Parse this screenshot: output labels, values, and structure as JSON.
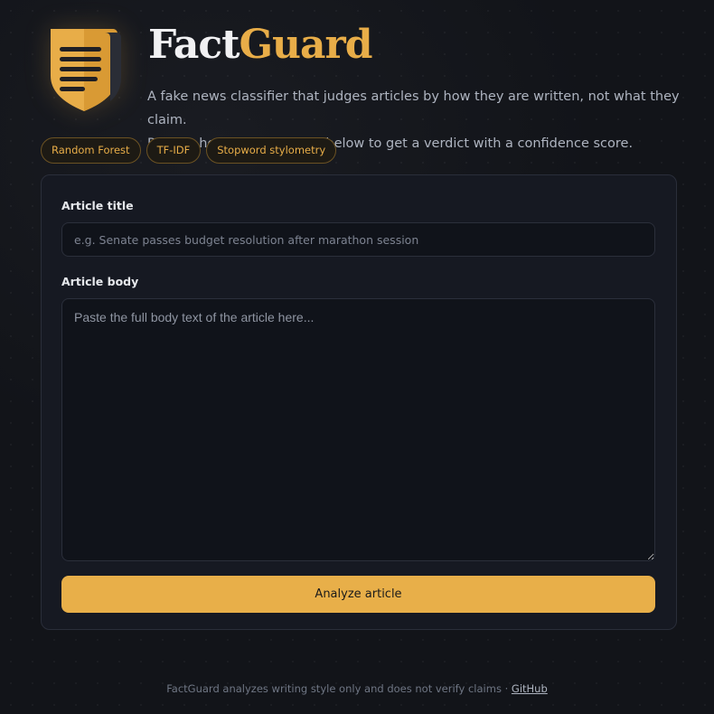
{
  "app": {
    "logo_icon": "shield-document-icon",
    "brand_part1": "Fact",
    "brand_part2": "Guard",
    "brand_accent_color": "#e8ad48",
    "description_line1": "A fake news classifier that judges articles by how they are written, not what they claim.",
    "description_line2": "Paste a headline and story below to get a verdict with a confidence score."
  },
  "tags": [
    "Random Forest",
    "TF-IDF",
    "Stopword stylometry"
  ],
  "form": {
    "title_label": "Article title",
    "title_placeholder": "e.g. Senate passes budget resolution after marathon session",
    "title_value": "",
    "body_label": "Article body",
    "body_placeholder": "Paste the full body text of the article here...",
    "body_value": "",
    "submit_label": "Analyze article",
    "submit_color": "#e8af49"
  },
  "footer": {
    "text": "FactGuard analyzes writing style only and does not verify claims · ",
    "link_label": "GitHub"
  }
}
